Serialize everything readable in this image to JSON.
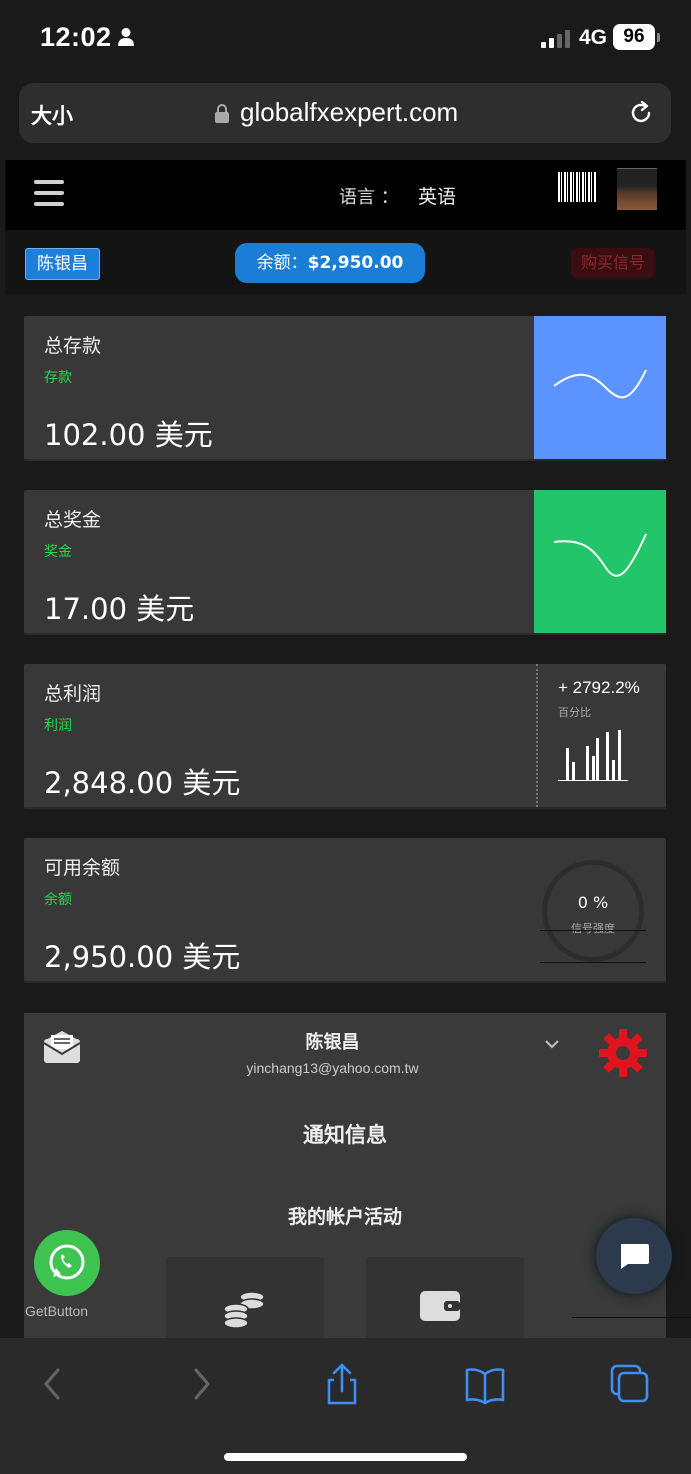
{
  "status_bar": {
    "time": "12:02",
    "network": "4G",
    "battery": "96"
  },
  "url_bar": {
    "text_size_label": "大小",
    "domain": "globalfxexpert.com"
  },
  "header": {
    "language_label": "语言 ：",
    "language_value": "英语"
  },
  "sub_header": {
    "user_name": "陈银昌",
    "balance_label": "余额：",
    "balance_value": "$2,950.00",
    "buy_signal_label": "购买信号"
  },
  "cards": [
    {
      "title": "总存款",
      "subtitle": "存款",
      "value": "102.00 美元",
      "panel_color": "#5b94ff"
    },
    {
      "title": "总奖金",
      "subtitle": "奖金",
      "value": "17.00 美元",
      "panel_color": "#22c56a"
    },
    {
      "title": "总利润",
      "subtitle": "利润",
      "value": "2,848.00 美元",
      "percent": "+ 2792.2%",
      "percent_label": "百分比"
    },
    {
      "title": "可用余额",
      "subtitle": "余额",
      "value": "2,950.00 美元",
      "signal_value": "0 %",
      "signal_label": "信号强度"
    }
  ],
  "profile": {
    "name": "陈银昌",
    "email": "yinchang13@yahoo.com.tw",
    "notifications_label": "通知信息",
    "activity_label": "我的帐户活动"
  },
  "getbutton_label": "GetButton",
  "colors": {
    "accent_blue": "#1a7ed6",
    "green": "#27d84a",
    "gear_red": "#e0141e",
    "whatsapp": "#3fc351"
  },
  "icons": [
    "person-icon",
    "lock-icon",
    "reload-icon",
    "hamburger-icon",
    "mail-icon",
    "chevron-down-icon",
    "gear-icon",
    "coins-icon",
    "wallet-icon",
    "whatsapp-icon",
    "chat-icon",
    "back-icon",
    "forward-icon",
    "share-icon",
    "bookmarks-icon",
    "tabs-icon"
  ]
}
